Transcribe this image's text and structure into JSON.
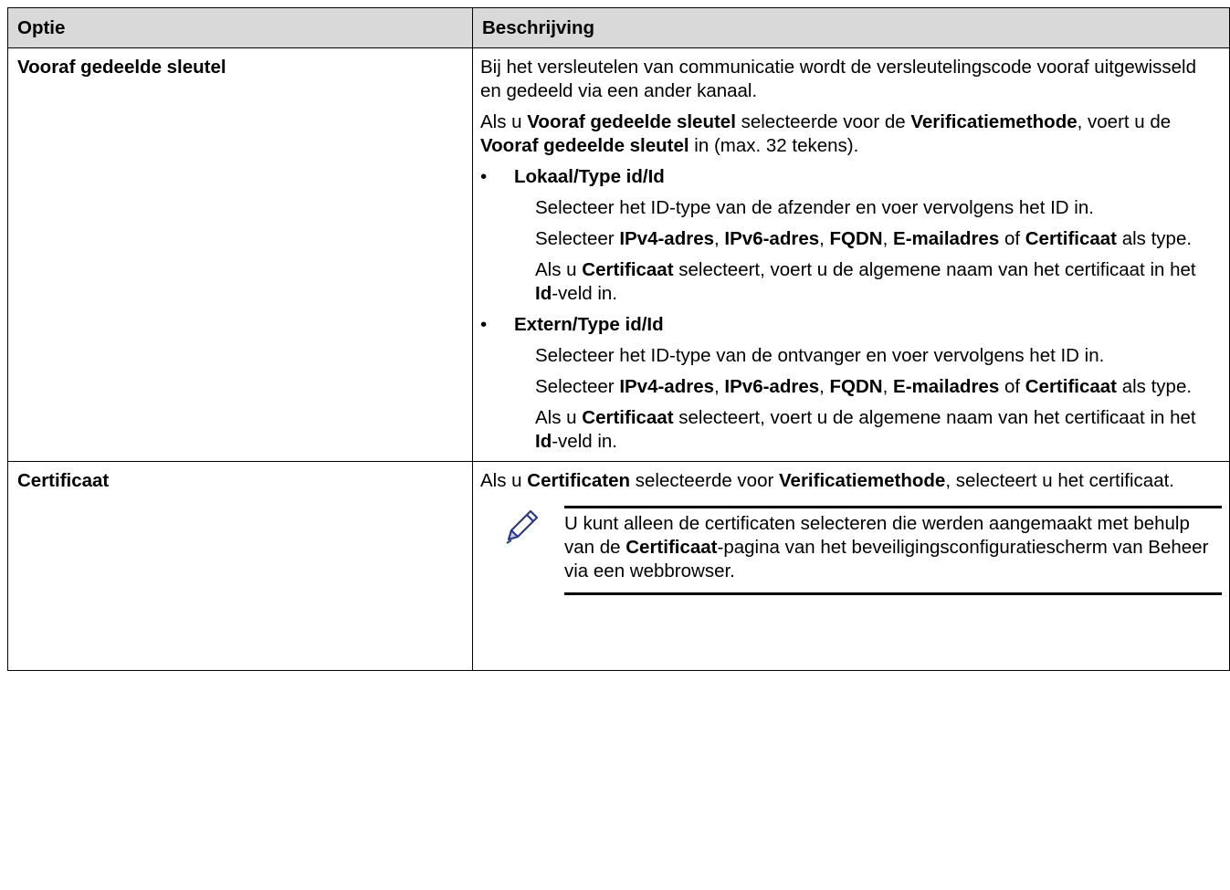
{
  "table": {
    "header": {
      "col1": "Optie",
      "col2": "Beschrijving"
    },
    "row1": {
      "option": "Vooraf gedeelde sleutel",
      "p1": "Bij het versleutelen van communicatie wordt de versleutelingscode vooraf uitgewisseld en gedeeld via een ander kanaal.",
      "p2": {
        "t1": "Als u ",
        "b1": "Vooraf gedeelde sleutel",
        "t2": " selecteerde voor de ",
        "b2": "Verificatiemethode",
        "t3": ", voert u de ",
        "b3": "Vooraf gedeelde sleutel",
        "t4": " in (max. 32 tekens)."
      },
      "bullet1": {
        "dot": "•",
        "label": "Lokaal/Type id/Id",
        "s1": "Selecteer het ID-type van de afzender en voer vervolgens het ID in.",
        "s2": {
          "t1": "Selecteer ",
          "b1": "IPv4-adres",
          "t2": ", ",
          "b2": "IPv6-adres",
          "t3": ", ",
          "b3": "FQDN",
          "t4": ", ",
          "b4": "E-mailadres",
          "t5": " of ",
          "b5": "Certificaat",
          "t6": " als type."
        },
        "s3": {
          "t1": "Als u ",
          "b1": "Certificaat",
          "t2": " selecteert, voert u de algemene naam van het certificaat in het ",
          "b2": "Id",
          "t3": "-veld in."
        }
      },
      "bullet2": {
        "dot": "•",
        "label": "Extern/Type id/Id",
        "s1": "Selecteer het ID-type van de ontvanger en voer vervolgens het ID in.",
        "s2": {
          "t1": "Selecteer ",
          "b1": "IPv4-adres",
          "t2": ", ",
          "b2": "IPv6-adres",
          "t3": ", ",
          "b3": "FQDN",
          "t4": ", ",
          "b4": "E-mailadres",
          "t5": " of ",
          "b5": "Certificaat",
          "t6": " als type."
        },
        "s3": {
          "t1": "Als u ",
          "b1": "Certificaat",
          "t2": " selecteert, voert u de algemene naam van het certificaat in het ",
          "b2": "Id",
          "t3": "-veld in."
        }
      }
    },
    "row2": {
      "option": "Certificaat",
      "p1": {
        "t1": "Als u ",
        "b1": "Certificaten",
        "t2": " selecteerde voor ",
        "b2": "Verificatiemethode",
        "t3": ", selecteert u het certificaat."
      },
      "note": {
        "icon": "pencil-icon",
        "t1": "U kunt alleen de certificaten selecteren die werden aangemaakt met behulp van de ",
        "b1": "Certificaat",
        "t2": "-pagina van het beveiligingsconfiguratiescherm van Beheer via een webbrowser."
      }
    }
  }
}
